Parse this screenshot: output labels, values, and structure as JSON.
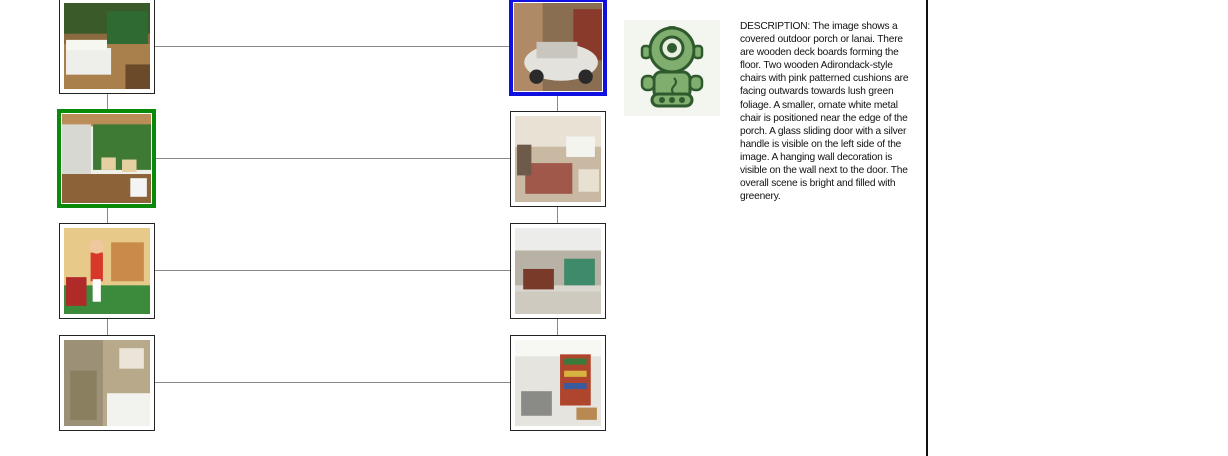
{
  "left_column": {
    "items": [
      {
        "icon": "bedroom-photo",
        "state": "normal"
      },
      {
        "icon": "porch-photo",
        "state": "selected-green"
      },
      {
        "icon": "playroom-photo",
        "state": "normal"
      },
      {
        "icon": "bathroom-photo",
        "state": "normal"
      }
    ]
  },
  "right_column": {
    "items": [
      {
        "icon": "car-garage-photo",
        "state": "selected-blue"
      },
      {
        "icon": "living-room-photo",
        "state": "normal"
      },
      {
        "icon": "lobby-photo",
        "state": "normal"
      },
      {
        "icon": "store-interior-photo",
        "state": "normal"
      }
    ]
  },
  "detail": {
    "icon": "robot-icon",
    "description": "DESCRIPTION: The image shows a covered outdoor porch or lanai. There are wooden deck boards forming the floor. Two wooden Adirondack-style chairs with pink patterned cushions are facing outwards towards lush green foliage. A smaller, ornate white metal chair is positioned near the edge of the porch. A glass sliding door with a silver handle is visible on the left side of the image. A hanging wall decoration is visible on the wall next to the door. The overall scene is bright and filled with greenery."
  },
  "colors": {
    "selected_left": "#0a8a0a",
    "selected_right": "#1010e0",
    "connector": "#8a8a8a"
  }
}
